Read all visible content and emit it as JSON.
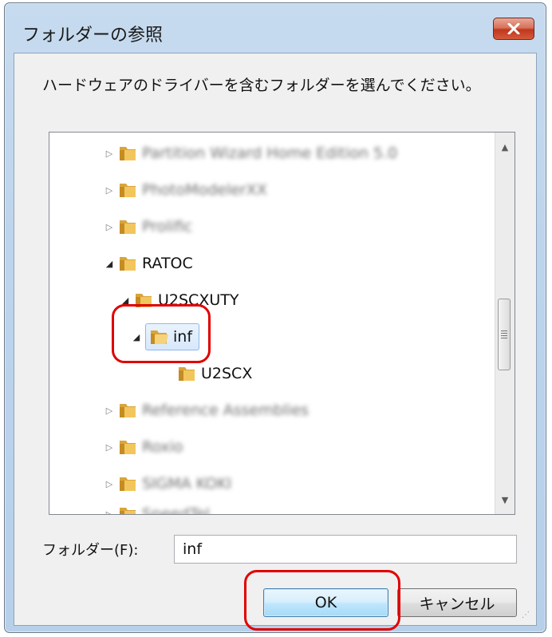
{
  "window": {
    "title": "フォルダーの参照",
    "close_glyph": "✕"
  },
  "instruction": "ハードウェアのドライバーを含むフォルダーを選んでください。",
  "tree": {
    "items": [
      {
        "label": "Partition Wizard Home Edition 5.0",
        "expander": "▷",
        "blurred": true
      },
      {
        "label": "PhotoModelerXX",
        "expander": "▷",
        "blurred": true
      },
      {
        "label": "Prolific",
        "expander": "▷",
        "blurred": true
      },
      {
        "label": "RATOC",
        "expander": "◢",
        "blurred": false
      },
      {
        "label": "U2SCXUTY",
        "expander": "◢",
        "blurred": false
      },
      {
        "label": "inf",
        "expander": "◢",
        "blurred": false,
        "selected": true
      },
      {
        "label": "U2SCX",
        "expander": "",
        "blurred": false
      },
      {
        "label": "Reference Assemblies",
        "expander": "▷",
        "blurred": true
      },
      {
        "label": "Roxio",
        "expander": "▷",
        "blurred": true
      },
      {
        "label": "SIGMA KOKI",
        "expander": "▷",
        "blurred": true
      },
      {
        "label": "SpeedTel",
        "expander": "▷",
        "blurred": true
      }
    ]
  },
  "scrollbar": {
    "up_glyph": "▲",
    "down_glyph": "▼"
  },
  "folder_field": {
    "label": "フォルダー(F):",
    "value": "inf"
  },
  "buttons": {
    "ok": "OK",
    "cancel": "キャンセル"
  },
  "colors": {
    "highlight": "#e00000",
    "selection": "#d7e8fb",
    "folder": "#e8b94a"
  }
}
